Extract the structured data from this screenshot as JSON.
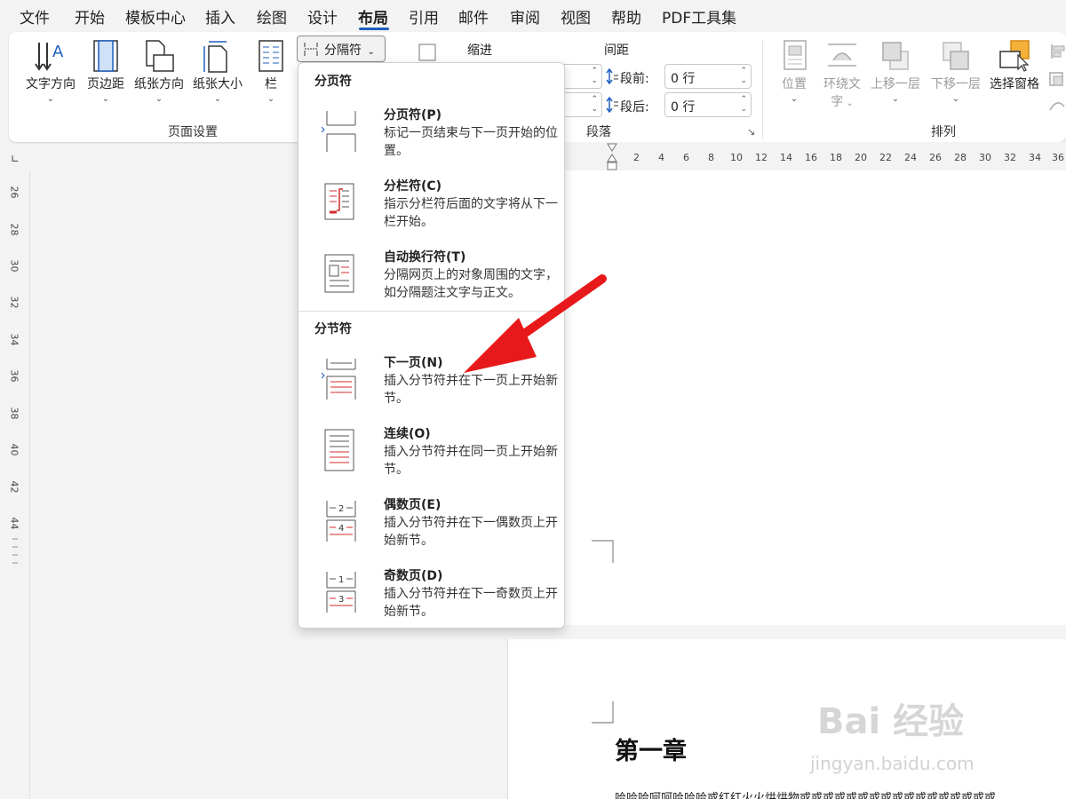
{
  "menu": {
    "tabs": [
      "文件",
      "开始",
      "模板中心",
      "插入",
      "绘图",
      "设计",
      "布局",
      "引用",
      "邮件",
      "审阅",
      "视图",
      "帮助",
      "PDF工具集"
    ],
    "active_tab": "布局"
  },
  "ribbon": {
    "page_setup": {
      "label": "页面设置",
      "buttons": [
        "文字方向",
        "页边距",
        "纸张方向",
        "纸张大小",
        "栏"
      ]
    },
    "breaks_button": "分隔符",
    "paragraph": {
      "label": "段落",
      "indent_title": "缩进",
      "spacing_title": "间距",
      "space_before_label": "段前:",
      "space_before_value": "0 行",
      "space_after_label": "段后:",
      "space_after_value": "0 行"
    },
    "arrange": {
      "label": "排列",
      "buttons": [
        "位置",
        "环绕文字",
        "上移一层",
        "下移一层",
        "选择窗格"
      ],
      "wrap_text_line1": "环绕文",
      "wrap_text_line2": "字"
    }
  },
  "dropdown": {
    "page_breaks_title": "分页符",
    "section_breaks_title": "分节符",
    "items": [
      {
        "title": "分页符(P)",
        "desc": "标记一页结束与下一页开始的位置。"
      },
      {
        "title": "分栏符(C)",
        "desc": "指示分栏符后面的文字将从下一栏开始。"
      },
      {
        "title": "自动换行符(T)",
        "desc": "分隔网页上的对象周围的文字，如分隔题注文字与正文。"
      },
      {
        "title": "下一页(N)",
        "desc": "插入分节符并在下一页上开始新节。"
      },
      {
        "title": "连续(O)",
        "desc": "插入分节符并在同一页上开始新节。"
      },
      {
        "title": "偶数页(E)",
        "desc": "插入分节符并在下一偶数页上开始新节。"
      },
      {
        "title": "奇数页(D)",
        "desc": "插入分节符并在下一奇数页上开始新节。"
      }
    ]
  },
  "hruler": [
    "2",
    "4",
    "6",
    "8",
    "10",
    "12",
    "14",
    "16",
    "18",
    "20",
    "22",
    "24",
    "26",
    "28",
    "30",
    "32",
    "34",
    "36"
  ],
  "vruler": [
    "26",
    "28",
    "30",
    "32",
    "34",
    "36",
    "38",
    "40",
    "42",
    "44"
  ],
  "document": {
    "chapter_title": "第一章",
    "body_start": "哈哈哈呵呵哈哈哈或红红火火烘烘物或或或或或或或或或或或或或或或或或"
  },
  "watermark": {
    "text": "Bai 经验",
    "url": "jingyan.baidu.com"
  },
  "colors": {
    "accent": "#1f5fbf",
    "arrow": "#e8191a",
    "icon_red": "#d42a2a"
  }
}
